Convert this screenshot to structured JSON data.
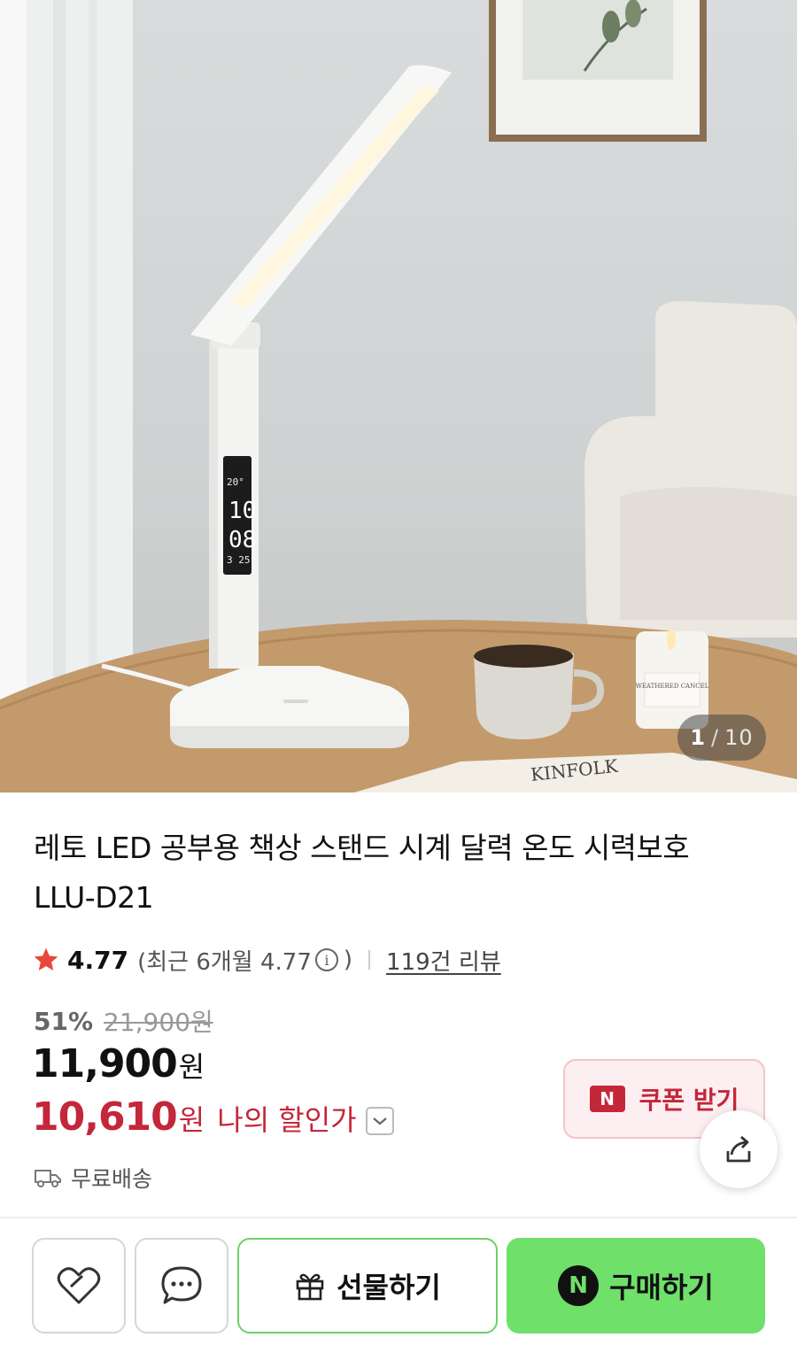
{
  "gallery": {
    "current": "1",
    "separator": "/",
    "total": "10",
    "book_text": "KINFOLK",
    "candle_label": "WEATHERED CANCEL"
  },
  "product": {
    "title": "레토 LED 공부용 책상 스탠드 시계 달력 온도 시력보호 LLU-D21"
  },
  "rating": {
    "icon": "star-icon",
    "value": "4.77",
    "recent_open": "(최근 6개월 4.77",
    "info_icon": "i",
    "recent_close": ")",
    "review_link": "119건 리뷰"
  },
  "price": {
    "discount_pct": "51%",
    "original": "21,900원",
    "sale_number": "11,900",
    "sale_unit": "원",
    "my_number": "10,610",
    "my_unit": "원",
    "my_label": "나의 할인가"
  },
  "coupon": {
    "badge": "N",
    "label": "쿠폰 받기"
  },
  "shipping": {
    "label": "무료배송"
  },
  "actions": {
    "gift_label": "선물하기",
    "buy_badge": "N",
    "buy_label": "구매하기"
  },
  "colors": {
    "accent_red": "#c4263a",
    "buy_green": "#6fe06a",
    "star": "#e8483a"
  }
}
